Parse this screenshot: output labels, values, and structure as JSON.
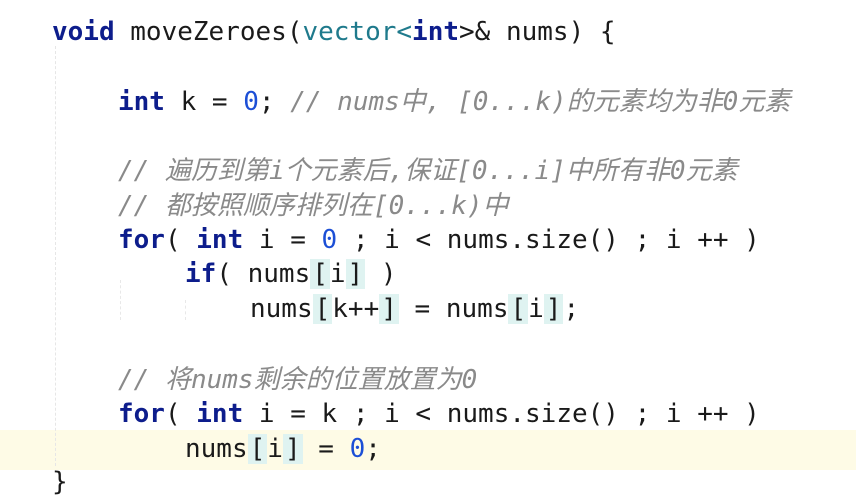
{
  "code": {
    "line1": {
      "void": "void",
      "func": "moveZeroes(",
      "type": "vector",
      "lt": "<",
      "int": "int",
      "rest": ">& nums) {"
    },
    "line2": {
      "kw": "int",
      "code": " k = ",
      "zero": "0",
      "semi": "; ",
      "comment": "// nums中, [0...k)的元素均为非0元素"
    },
    "line3": {
      "comment": "// 遍历到第i个元素后,保证[0...i]中所有非0元素"
    },
    "line4": {
      "comment": "// 都按照顺序排列在[0...k)中"
    },
    "line5": {
      "for": "for",
      "p1": "( ",
      "int": "int",
      "p2": " i = ",
      "zero": "0",
      "p3": " ; i < nums.size() ; i ++ )"
    },
    "line6": {
      "if": "if",
      "p1": "( nums",
      "lb": "[",
      "idx": "i",
      "rb": "]",
      "p2": " )"
    },
    "line7": {
      "a": "nums",
      "lb": "[",
      "k": "k++",
      "rb": "]",
      "mid": " = nums",
      "lb2": "[",
      "i": "i",
      "rb2": "]",
      "end": ";"
    },
    "line8": {
      "comment": "// 将nums剩余的位置放置为0"
    },
    "line9": {
      "for": "for",
      "p1": "( ",
      "int": "int",
      "p2": " i = k ; i < nums.size() ; i ++ )"
    },
    "line10": {
      "a": "nums",
      "lb": "[",
      "i": "i",
      "rb": "]",
      "mid": " = ",
      "zero": "0",
      "end": ";"
    },
    "line11": {
      "brace": "}"
    }
  },
  "colors": {
    "keyword": "#0d1d8c",
    "type": "#1f7a8c",
    "number": "#1c4fd6",
    "comment": "#8a8a8a",
    "current_line": "#fefbe6",
    "bracket_highlight": "#dff3f1"
  }
}
